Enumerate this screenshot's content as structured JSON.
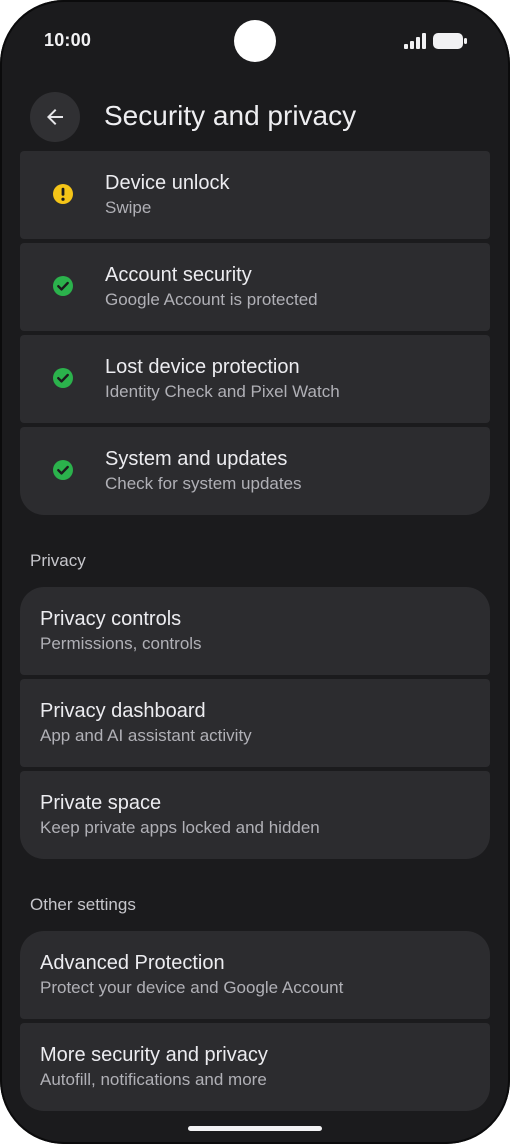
{
  "status_bar": {
    "time": "10:00"
  },
  "header": {
    "title": "Security and privacy"
  },
  "security_items": [
    {
      "title": "Device unlock",
      "subtitle": "Swipe",
      "status": "warning",
      "status_color": "#f5c518"
    },
    {
      "title": "Account security",
      "subtitle": "Google Account is protected",
      "status": "ok",
      "status_color": "#2bb24c"
    },
    {
      "title": "Lost device protection",
      "subtitle": "Identity Check and Pixel Watch",
      "status": "ok",
      "status_color": "#2bb24c"
    },
    {
      "title": "System and updates",
      "subtitle": "Check for system updates",
      "status": "ok",
      "status_color": "#2bb24c"
    }
  ],
  "privacy": {
    "label": "Privacy",
    "items": [
      {
        "title": "Privacy controls",
        "subtitle": "Permissions, controls"
      },
      {
        "title": "Privacy dashboard",
        "subtitle": "App and AI assistant activity"
      },
      {
        "title": "Private space",
        "subtitle": "Keep private apps locked and hidden"
      }
    ]
  },
  "other_settings": {
    "label": "Other settings",
    "items": [
      {
        "title": "Advanced Protection",
        "subtitle": "Protect your device and Google Account"
      },
      {
        "title": "More security and privacy",
        "subtitle": "Autofill, notifications and more"
      }
    ]
  },
  "colors": {
    "background": "#1b1b1d",
    "card": "#2c2c2f",
    "warning": "#f5c518",
    "ok": "#2bb24c"
  }
}
